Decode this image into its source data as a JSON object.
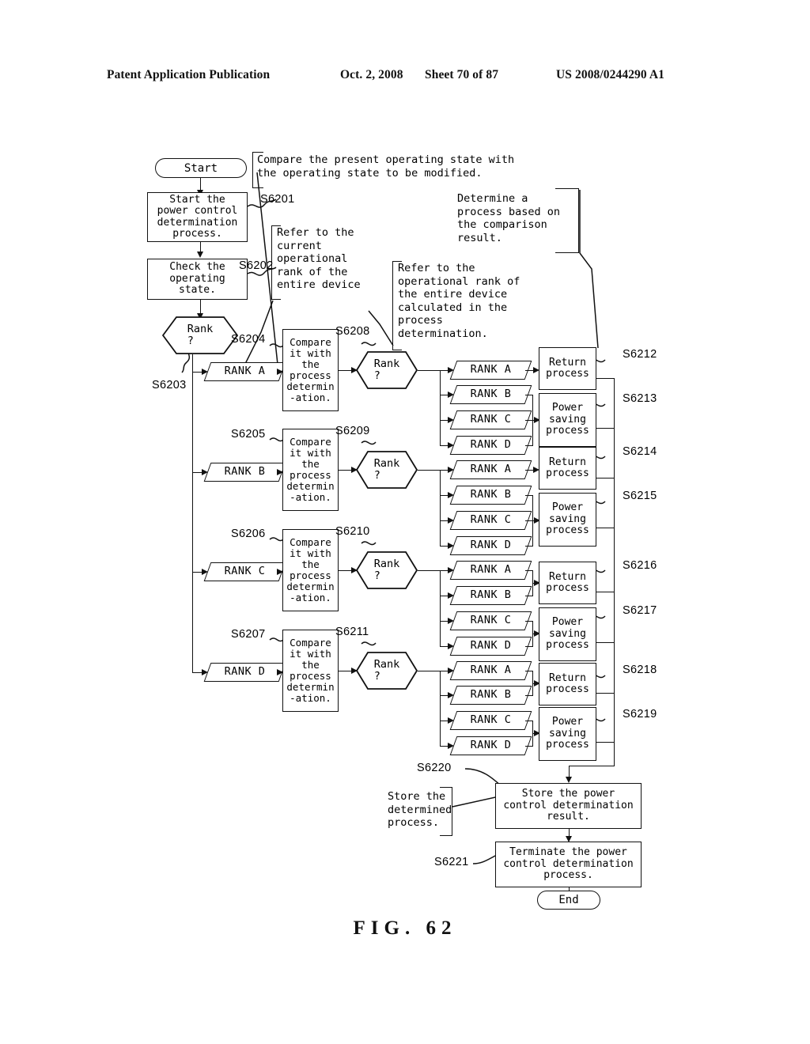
{
  "header": {
    "publication": "Patent Application Publication",
    "date": "Oct. 2, 2008",
    "sheet": "Sheet 70 of 87",
    "number": "US 2008/0244290 A1"
  },
  "figure": {
    "caption": "FIG. 62"
  },
  "flowchart": {
    "start_label": "Start",
    "end_label": "End",
    "process_start": "Start the\npower control\ndetermination\nprocess.",
    "process_check": "Check the\noperating\nstate.",
    "decision_rank": "Rank\n?",
    "compare_box": "Compare\nit with\nthe\nprocess\ndetermin\n-ation.",
    "rank_a": "RANK A",
    "rank_b": "RANK B",
    "rank_c": "RANK C",
    "rank_d": "RANK D",
    "return_process": "Return\nprocess",
    "power_saving_process": "Power\nsaving\nprocess",
    "store_result": "Store the power\ncontrol determination\nresult.",
    "terminate": "Terminate the power\ncontrol determination\nprocess."
  },
  "annotations": {
    "compare_states": "Compare the present operating state with\nthe operating state to be modified.",
    "refer_current": "Refer to the\ncurrent\noperational\nrank of the\nentire device",
    "determine_process": "Determine a\nprocess based on\nthe comparison\nresult.",
    "refer_operational": "Refer to the\noperational rank of\nthe entire device\ncalculated in the\nprocess\ndetermination.",
    "store_determined": "Store the\ndetermined\nprocess."
  },
  "steps": {
    "s6201": "S6201",
    "s6202": "S6202",
    "s6203": "S6203",
    "s6204": "S6204",
    "s6205": "S6205",
    "s6206": "S6206",
    "s6207": "S6207",
    "s6208": "S6208",
    "s6209": "S6209",
    "s6210": "S6210",
    "s6211": "S6211",
    "s6212": "S6212",
    "s6213": "S6213",
    "s6214": "S6214",
    "s6215": "S6215",
    "s6216": "S6216",
    "s6217": "S6217",
    "s6218": "S6218",
    "s6219": "S6219",
    "s6220": "S6220",
    "s6221": "S6221"
  }
}
